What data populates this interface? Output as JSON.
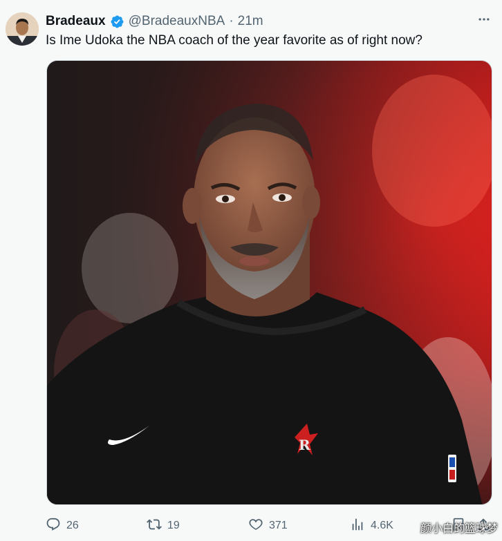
{
  "tweet": {
    "author": {
      "display_name": "Bradeaux",
      "handle": "@BradeauxNBA",
      "verified": true,
      "avatar_icon": "profile-photo"
    },
    "separator": "·",
    "time": "21m",
    "text": "Is Ime Udoka the NBA coach of the year favorite as of right now?",
    "media": {
      "kind": "photo"
    },
    "actions": {
      "replies": "26",
      "reposts": "19",
      "likes": "371",
      "views": "4.6K"
    }
  },
  "watermark": "颜小白的篮球梦",
  "colors": {
    "accent": "#1d9bf0",
    "text_primary": "#0f1419",
    "text_secondary": "#536471",
    "background": "#f7f9f9"
  }
}
